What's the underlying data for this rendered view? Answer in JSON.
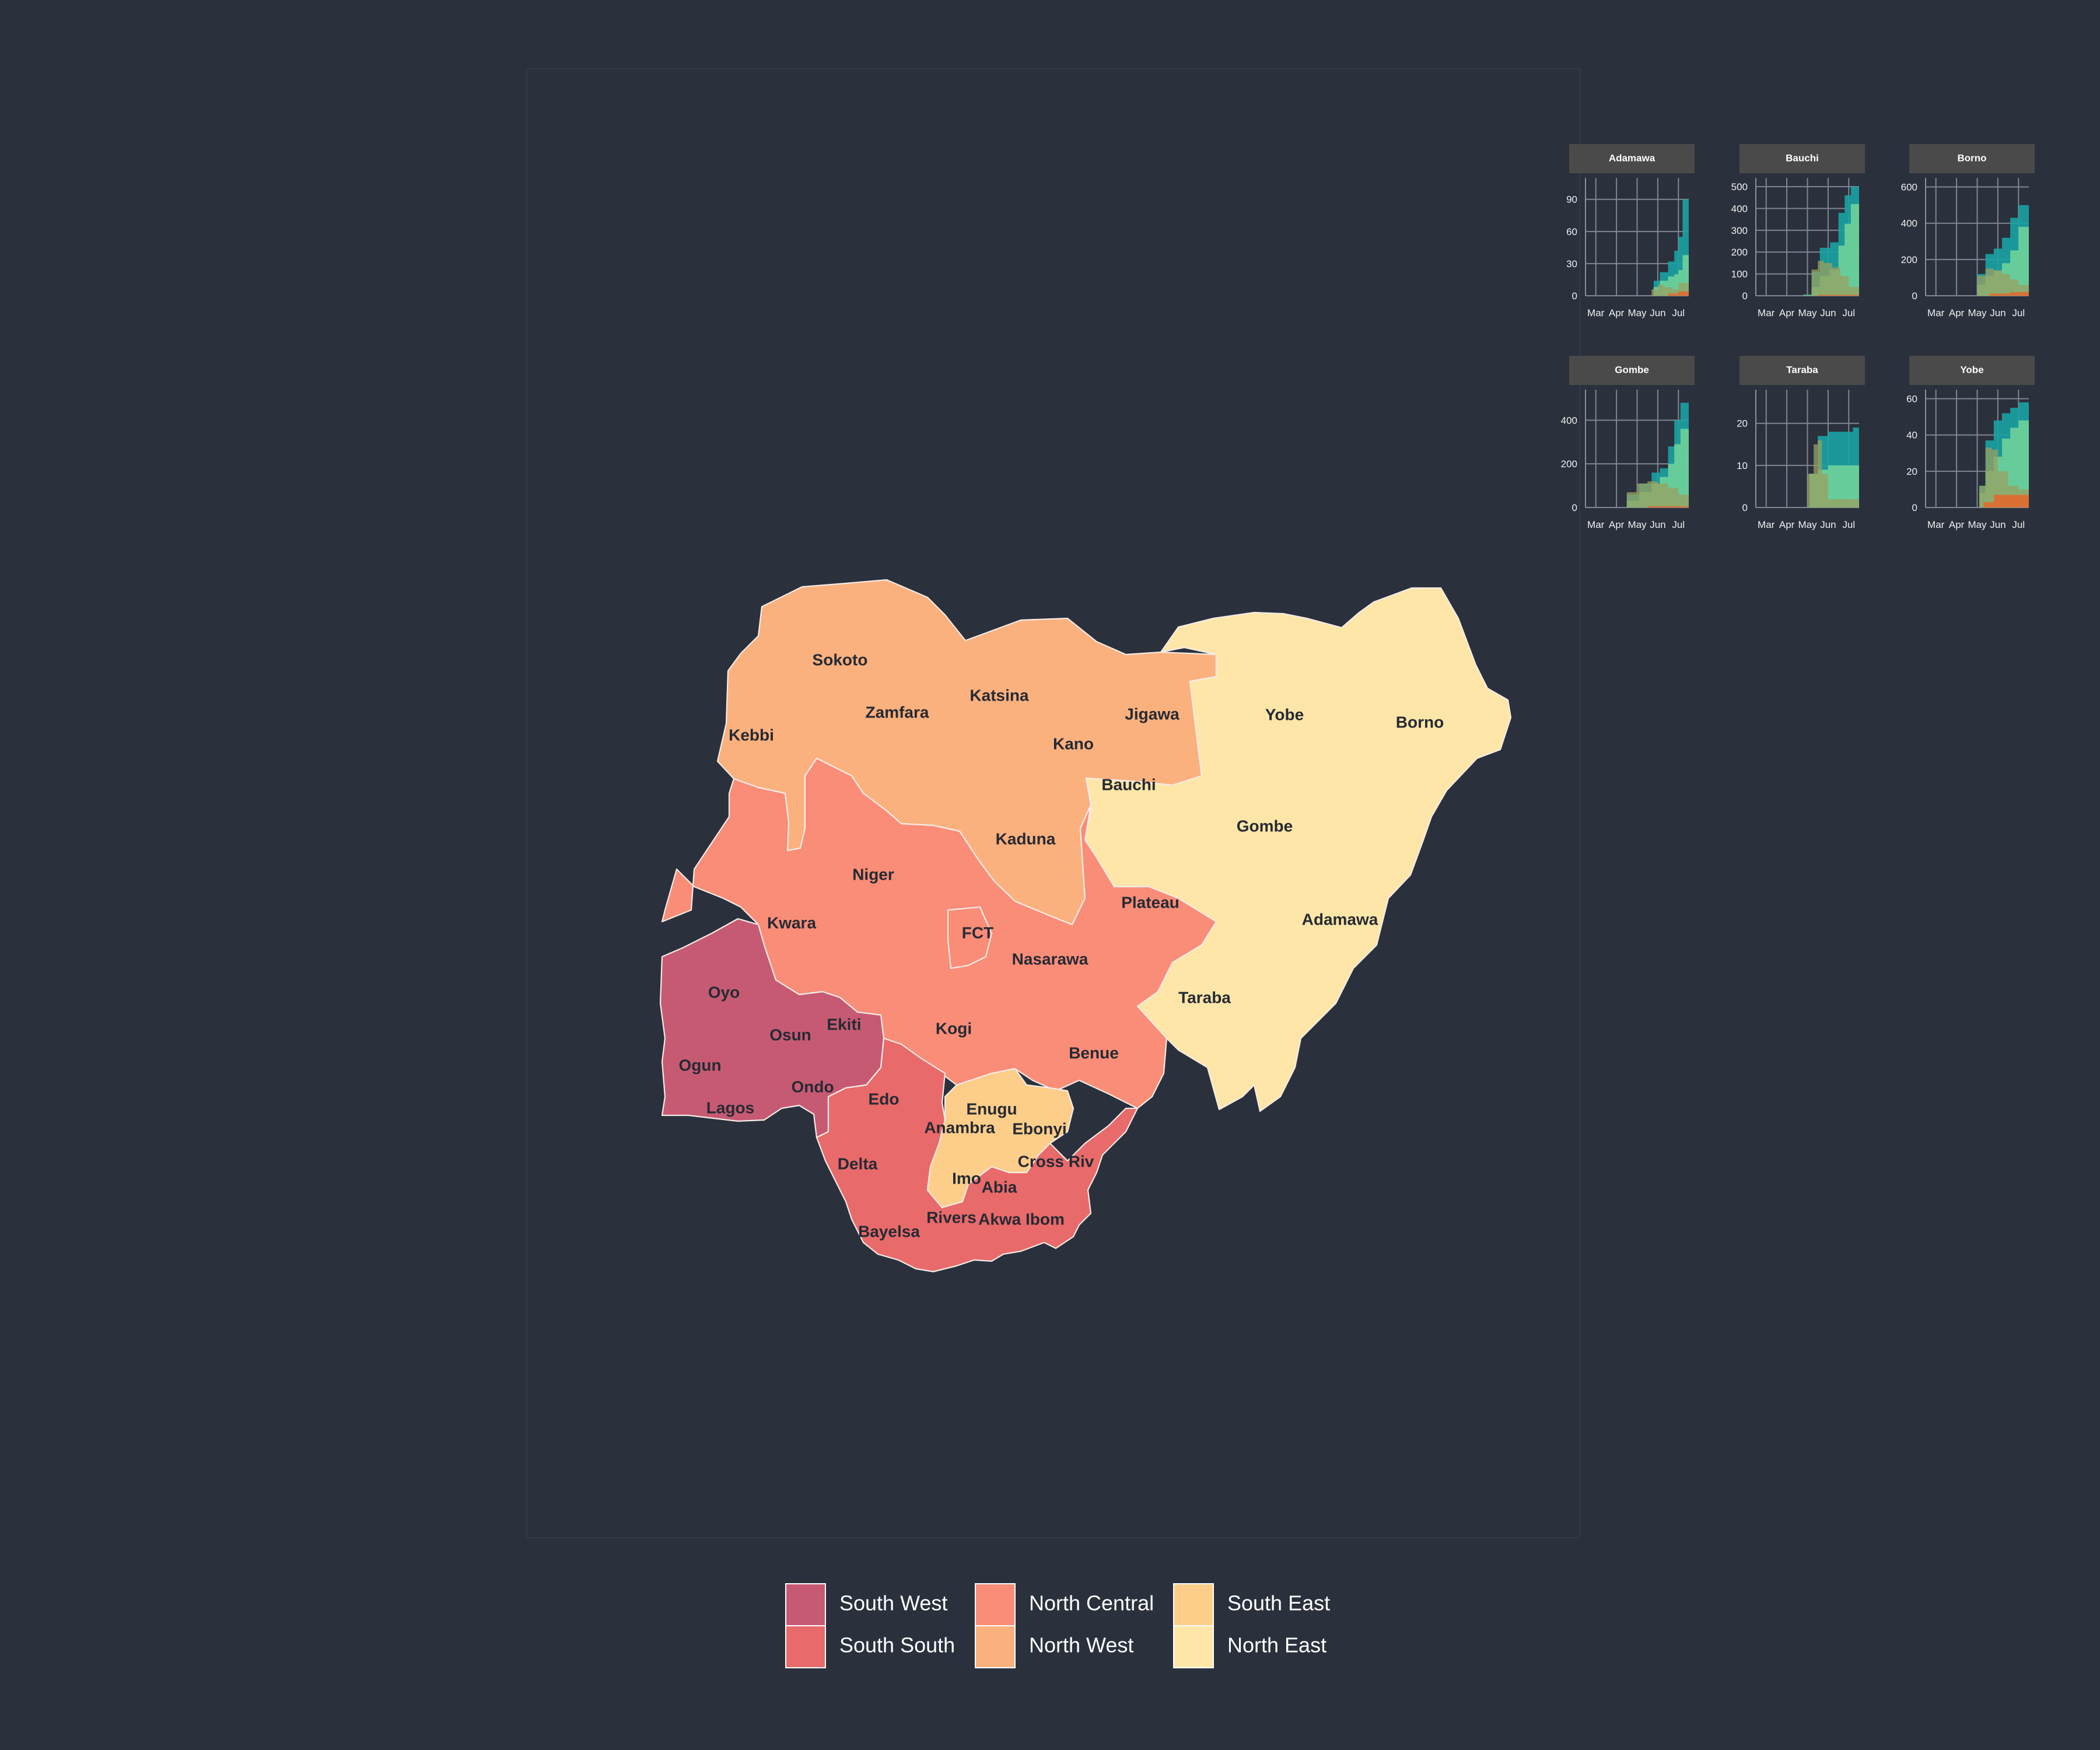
{
  "legend": {
    "items": [
      {
        "label": "South West",
        "color": "#c75a73"
      },
      {
        "label": "South South",
        "color": "#e86a6a"
      },
      {
        "label": "North Central",
        "color": "#f98d78"
      },
      {
        "label": "North West",
        "color": "#fbb17e"
      },
      {
        "label": "South East",
        "color": "#fdce89"
      },
      {
        "label": "North East",
        "color": "#fde6a8"
      }
    ]
  },
  "map": {
    "states": [
      {
        "name": "Sokoto",
        "region": "North West"
      },
      {
        "name": "Zamfara",
        "region": "North West"
      },
      {
        "name": "Kebbi",
        "region": "North West"
      },
      {
        "name": "Katsina",
        "region": "North West"
      },
      {
        "name": "Kano",
        "region": "North West"
      },
      {
        "name": "Jigawa",
        "region": "North West"
      },
      {
        "name": "Kaduna",
        "region": "North West"
      },
      {
        "name": "Yobe",
        "region": "North East"
      },
      {
        "name": "Borno",
        "region": "North East"
      },
      {
        "name": "Bauchi",
        "region": "North East"
      },
      {
        "name": "Gombe",
        "region": "North East"
      },
      {
        "name": "Adamawa",
        "region": "North East"
      },
      {
        "name": "Taraba",
        "region": "North East"
      },
      {
        "name": "Niger",
        "region": "North Central"
      },
      {
        "name": "Kwara",
        "region": "North Central"
      },
      {
        "name": "FCT",
        "region": "North Central"
      },
      {
        "name": "Nasarawa",
        "region": "North Central"
      },
      {
        "name": "Plateau",
        "region": "North Central"
      },
      {
        "name": "Kogi",
        "region": "North Central"
      },
      {
        "name": "Benue",
        "region": "North Central"
      },
      {
        "name": "Oyo",
        "region": "South West"
      },
      {
        "name": "Osun",
        "region": "South West"
      },
      {
        "name": "Ekiti",
        "region": "South West"
      },
      {
        "name": "Ogun",
        "region": "South West"
      },
      {
        "name": "Ondo",
        "region": "South West"
      },
      {
        "name": "Lagos",
        "region": "South West"
      },
      {
        "name": "Edo",
        "region": "South South"
      },
      {
        "name": "Delta",
        "region": "South South"
      },
      {
        "name": "Bayelsa",
        "region": "South South"
      },
      {
        "name": "Rivers",
        "region": "South South"
      },
      {
        "name": "Akwa Ibom",
        "region": "South South"
      },
      {
        "name": "Cross River",
        "label": "Cross Riv",
        "region": "South South"
      },
      {
        "name": "Enugu",
        "region": "South East"
      },
      {
        "name": "Anambra",
        "region": "South East"
      },
      {
        "name": "Ebonyi",
        "region": "South East"
      },
      {
        "name": "Imo",
        "region": "South East"
      },
      {
        "name": "Abia",
        "region": "South East"
      }
    ]
  },
  "chart_data": [
    {
      "type": "area",
      "title": "Adamawa",
      "x_ticks": [
        "Mar",
        "Apr",
        "May",
        "Jun",
        "Jul"
      ],
      "y_ticks": [
        0,
        30,
        60,
        90
      ],
      "ylim": [
        0,
        110
      ],
      "series": [
        {
          "color": "#1aa3a3",
          "x": [
            0.58,
            0.66,
            0.72,
            0.8,
            0.86,
            0.9,
            0.94,
            1.0
          ],
          "y": [
            0,
            14,
            22,
            32,
            42,
            55,
            90,
            103
          ]
        },
        {
          "color": "#6fd39a",
          "x": [
            0.58,
            0.66,
            0.72,
            0.8,
            0.86,
            0.9,
            0.94,
            1.0
          ],
          "y": [
            0,
            8,
            14,
            18,
            20,
            24,
            38,
            52
          ]
        },
        {
          "color": "#9aa060",
          "x": [
            0.58,
            0.64,
            0.7,
            0.76,
            0.84,
            0.9,
            1.0
          ],
          "y": [
            0,
            6,
            10,
            8,
            6,
            12,
            14
          ]
        },
        {
          "color": "#e06a2c",
          "x": [
            0.58,
            0.8,
            0.9,
            1.0
          ],
          "y": [
            0,
            2,
            4,
            7
          ]
        }
      ]
    },
    {
      "type": "area",
      "title": "Bauchi",
      "x_ticks": [
        "Mar",
        "Apr",
        "May",
        "Jun",
        "Jul"
      ],
      "y_ticks": [
        0,
        100,
        200,
        300,
        400,
        500
      ],
      "ylim": [
        0,
        540
      ],
      "series": [
        {
          "color": "#1aa3a3",
          "x": [
            0.3,
            0.46,
            0.54,
            0.62,
            0.72,
            0.8,
            0.86,
            0.92,
            1.0
          ],
          "y": [
            0,
            6,
            110,
            220,
            245,
            380,
            460,
            500,
            520
          ]
        },
        {
          "color": "#6fd39a",
          "x": [
            0.3,
            0.46,
            0.54,
            0.62,
            0.72,
            0.8,
            0.86,
            0.92,
            1.0
          ],
          "y": [
            0,
            3,
            40,
            90,
            120,
            230,
            330,
            420,
            470
          ]
        },
        {
          "color": "#9aa060",
          "x": [
            0.3,
            0.46,
            0.54,
            0.6,
            0.66,
            0.74,
            0.82,
            0.9,
            1.0
          ],
          "y": [
            0,
            3,
            120,
            160,
            150,
            130,
            90,
            40,
            20
          ]
        },
        {
          "color": "#e06a2c",
          "x": [
            0.3,
            0.6,
            1.0
          ],
          "y": [
            0,
            4,
            14
          ]
        }
      ]
    },
    {
      "type": "area",
      "title": "Borno",
      "x_ticks": [
        "Mar",
        "Apr",
        "May",
        "Jun",
        "Jul"
      ],
      "y_ticks": [
        0,
        200,
        400,
        600
      ],
      "ylim": [
        0,
        650
      ],
      "series": [
        {
          "color": "#1aa3a3",
          "x": [
            0.42,
            0.5,
            0.58,
            0.66,
            0.74,
            0.82,
            0.9,
            1.0
          ],
          "y": [
            0,
            120,
            230,
            260,
            320,
            430,
            500,
            580
          ]
        },
        {
          "color": "#6fd39a",
          "x": [
            0.42,
            0.5,
            0.58,
            0.66,
            0.74,
            0.82,
            0.9,
            1.0
          ],
          "y": [
            0,
            60,
            110,
            140,
            180,
            250,
            380,
            490
          ]
        },
        {
          "color": "#9aa060",
          "x": [
            0.42,
            0.5,
            0.58,
            0.66,
            0.74,
            0.82,
            0.9,
            1.0
          ],
          "y": [
            0,
            110,
            150,
            140,
            120,
            90,
            60,
            50
          ]
        },
        {
          "color": "#e06a2c",
          "x": [
            0.42,
            0.62,
            0.82,
            1.0
          ],
          "y": [
            0,
            12,
            20,
            30
          ]
        }
      ]
    },
    {
      "type": "area",
      "title": "Gombe",
      "x_ticks": [
        "Mar",
        "Apr",
        "May",
        "Jun",
        "Jul"
      ],
      "y_ticks": [
        0,
        200,
        400
      ],
      "ylim": [
        0,
        540
      ],
      "series": [
        {
          "color": "#1aa3a3",
          "x": [
            0.28,
            0.4,
            0.52,
            0.64,
            0.72,
            0.8,
            0.86,
            0.92,
            1.0
          ],
          "y": [
            0,
            60,
            110,
            160,
            180,
            280,
            400,
            480,
            520
          ]
        },
        {
          "color": "#6fd39a",
          "x": [
            0.28,
            0.4,
            0.52,
            0.64,
            0.72,
            0.8,
            0.86,
            0.92,
            1.0
          ],
          "y": [
            0,
            30,
            70,
            110,
            140,
            200,
            290,
            360,
            400
          ]
        },
        {
          "color": "#9aa060",
          "x": [
            0.28,
            0.4,
            0.5,
            0.6,
            0.7,
            0.8,
            0.9,
            1.0
          ],
          "y": [
            0,
            70,
            110,
            120,
            110,
            90,
            60,
            40
          ]
        },
        {
          "color": "#e06a2c",
          "x": [
            0.28,
            0.6,
            1.0
          ],
          "y": [
            0,
            6,
            18
          ]
        }
      ]
    },
    {
      "type": "area",
      "title": "Taraba",
      "x_ticks": [
        "Mar",
        "Apr",
        "May",
        "Jun",
        "Jul"
      ],
      "y_ticks": [
        0,
        10,
        20
      ],
      "ylim": [
        0,
        28
      ],
      "series": [
        {
          "color": "#1aa3a3",
          "x": [
            0.44,
            0.52,
            0.6,
            0.7,
            0.82,
            0.94,
            1.0
          ],
          "y": [
            0,
            8,
            17,
            18,
            18,
            19,
            27
          ]
        },
        {
          "color": "#6fd39a",
          "x": [
            0.44,
            0.52,
            0.6,
            0.7,
            0.82,
            0.94,
            1.0
          ],
          "y": [
            0,
            8,
            9,
            10,
            10,
            10,
            16
          ]
        },
        {
          "color": "#9aa060",
          "x": [
            0.44,
            0.5,
            0.56,
            0.6,
            0.64,
            0.7,
            1.0
          ],
          "y": [
            0,
            8,
            15,
            16,
            8,
            2,
            2
          ]
        },
        {
          "color": "#e06a2c",
          "x": [
            0.44,
            0.7,
            1.0
          ],
          "y": [
            0,
            0,
            0
          ]
        }
      ]
    },
    {
      "type": "area",
      "title": "Yobe",
      "x_ticks": [
        "Mar",
        "Apr",
        "May",
        "Jun",
        "Jul"
      ],
      "y_ticks": [
        0,
        20,
        40,
        60
      ],
      "ylim": [
        0,
        65
      ],
      "series": [
        {
          "color": "#1aa3a3",
          "x": [
            0.46,
            0.52,
            0.58,
            0.66,
            0.74,
            0.82,
            0.9,
            1.0
          ],
          "y": [
            0,
            12,
            37,
            48,
            52,
            55,
            58,
            60
          ]
        },
        {
          "color": "#6fd39a",
          "x": [
            0.46,
            0.52,
            0.58,
            0.66,
            0.74,
            0.82,
            0.9,
            1.0
          ],
          "y": [
            0,
            8,
            20,
            28,
            38,
            44,
            48,
            52
          ]
        },
        {
          "color": "#9aa060",
          "x": [
            0.46,
            0.52,
            0.58,
            0.64,
            0.7,
            0.8,
            0.9,
            1.0
          ],
          "y": [
            0,
            12,
            33,
            32,
            20,
            12,
            10,
            8
          ]
        },
        {
          "color": "#e06a2c",
          "x": [
            0.46,
            0.56,
            0.66,
            1.0
          ],
          "y": [
            0,
            3,
            7,
            8
          ]
        }
      ]
    }
  ]
}
